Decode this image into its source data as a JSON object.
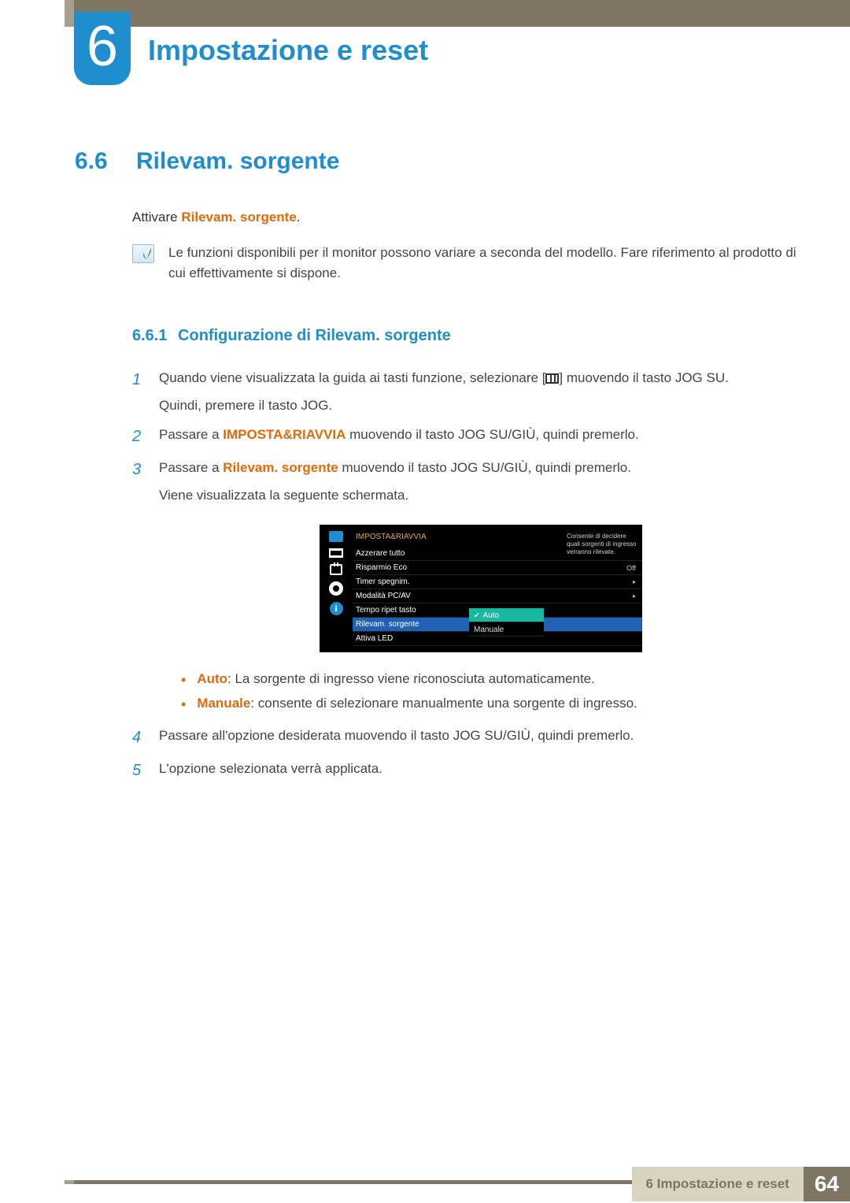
{
  "chapter": {
    "number": "6",
    "title": "Impostazione e reset"
  },
  "section": {
    "number": "6.6",
    "title": "Rilevam. sorgente"
  },
  "intro": {
    "prefix": "Attivare ",
    "emph": "Rilevam. sorgente",
    "suffix": "."
  },
  "note": "Le funzioni disponibili per il monitor possono variare a seconda del modello. Fare riferimento al prodotto di cui effettivamente si dispone.",
  "subsection": {
    "number": "6.6.1",
    "title": "Configurazione di Rilevam. sorgente"
  },
  "steps": {
    "s1a": "Quando viene visualizzata la guida ai tasti funzione, selezionare [",
    "s1b": "] muovendo il tasto JOG SU.",
    "s1c": "Quindi, premere il tasto JOG.",
    "s2a": "Passare a ",
    "s2emph": "IMPOSTA&RIAVVIA",
    "s2b": " muovendo il tasto JOG SU/GIÙ, quindi premerlo.",
    "s3a": "Passare a ",
    "s3emph": "Rilevam. sorgente",
    "s3b": " muovendo il tasto JOG SU/GIÙ, quindi premerlo.",
    "s3c": "Viene visualizzata la seguente schermata.",
    "s4": "Passare all'opzione desiderata muovendo il tasto JOG SU/GIÙ, quindi premerlo.",
    "s5": "L'opzione selezionata verrà applicata.",
    "n1": "1",
    "n2": "2",
    "n3": "3",
    "n4": "4",
    "n5": "5"
  },
  "osd": {
    "header": "IMPOSTA&RIAVVIA",
    "rows": [
      {
        "label": "Azzerare tutto",
        "value": ""
      },
      {
        "label": "Risparmio Eco",
        "value": "Off"
      },
      {
        "label": "Timer spegnim.",
        "value": "▸"
      },
      {
        "label": "Modalità PC/AV",
        "value": "▸"
      },
      {
        "label": "Tempo ripet tasto",
        "value": ""
      },
      {
        "label": "Rilevam. sorgente",
        "value": "",
        "selected": true
      },
      {
        "label": "Attiva LED",
        "value": ""
      }
    ],
    "popup": {
      "opt1": "Auto",
      "opt2": "Manuale"
    },
    "desc": "Consente di decidere quali sorgenti di ingresso verranno rilevate.",
    "side_info": "i"
  },
  "bullets": {
    "b1_emph": "Auto",
    "b1_text": ": La sorgente di ingresso viene riconosciuta automaticamente.",
    "b2_emph": "Manuale",
    "b2_text": ": consente di selezionare manualmente una sorgente di ingresso."
  },
  "footer": {
    "title": "6 Impostazione e reset",
    "page": "64"
  }
}
